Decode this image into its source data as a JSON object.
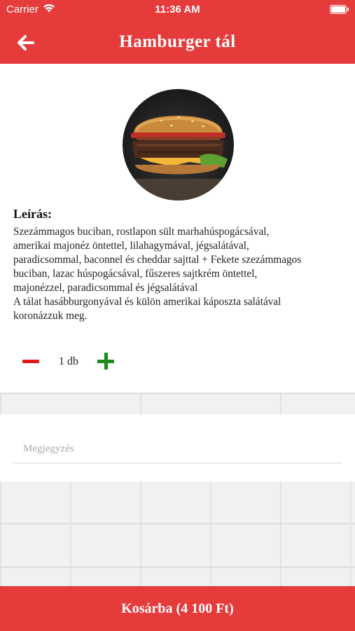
{
  "status_bar": {
    "carrier": "Carrier",
    "time": "11:36 AM",
    "wifi_icon": "wifi-icon",
    "battery_icon": "battery-icon"
  },
  "header": {
    "title": "Hamburger tál",
    "back_icon": "arrow-left-icon",
    "color": "#e53b3b"
  },
  "product": {
    "image_icon": "hamburger-image",
    "description_title": "Leírás:",
    "description": "Szezámmagos buciban, rostlapon sült marhahúspogácsával,\namerikai majonéz öntettel, lilahagymával, jégsalátával,\nparadicsommal, baconnel és cheddar sajttal + Fekete szezámmagos\nbuciban, lazac húspogácsával, fűszeres sajtkrém öntettel,\nmajonézzel, paradicsommal és jégsalátával\nA tálat hasábburgonyával és külön amerikai káposzta salátával\nkoronázzuk meg.",
    "quantity": "1 db",
    "minus_color": "#e0191b",
    "plus_color": "#1b8a1b"
  },
  "note": {
    "placeholder": "Megjegyzés",
    "value": ""
  },
  "footer": {
    "cart_button_label": "Kosárba (4 100 Ft)"
  }
}
